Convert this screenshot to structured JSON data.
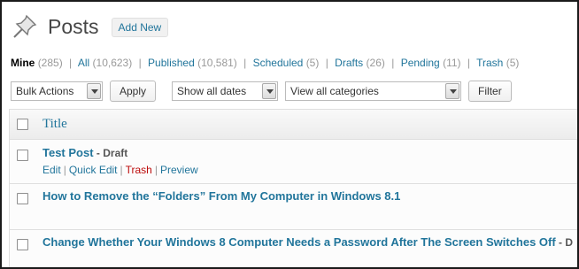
{
  "header": {
    "title": "Posts",
    "add_new_label": "Add New",
    "icon": "pushpin-icon"
  },
  "filters": [
    {
      "label": "Mine",
      "count": "(285)"
    },
    {
      "label": "All",
      "count": "(10,623)"
    },
    {
      "label": "Published",
      "count": "(10,581)"
    },
    {
      "label": "Scheduled",
      "count": "(5)"
    },
    {
      "label": "Drafts",
      "count": "(26)"
    },
    {
      "label": "Pending",
      "count": "(11)"
    },
    {
      "label": "Trash",
      "count": "(5)"
    }
  ],
  "separator": "|",
  "tablenav": {
    "bulk_actions": "Bulk Actions",
    "apply_label": "Apply",
    "dates_select": "Show all dates",
    "categories_select": "View all categories",
    "filter_label": "Filter"
  },
  "table": {
    "column_title": "Title",
    "rows": [
      {
        "title": "Test Post",
        "state_prefix": " - ",
        "state": "Draft",
        "actions": [
          "Edit",
          "Quick Edit",
          "Trash",
          "Preview"
        ]
      },
      {
        "title": "How to Remove the “Folders” From My Computer in Windows 8.1"
      },
      {
        "title": "Change Whether Your Windows 8 Computer Needs a Password After The Screen Switches Off",
        "trailing": " - D"
      }
    ]
  },
  "colors": {
    "link": "#21759b",
    "trash": "#bc0b0b",
    "muted": "#999999"
  }
}
